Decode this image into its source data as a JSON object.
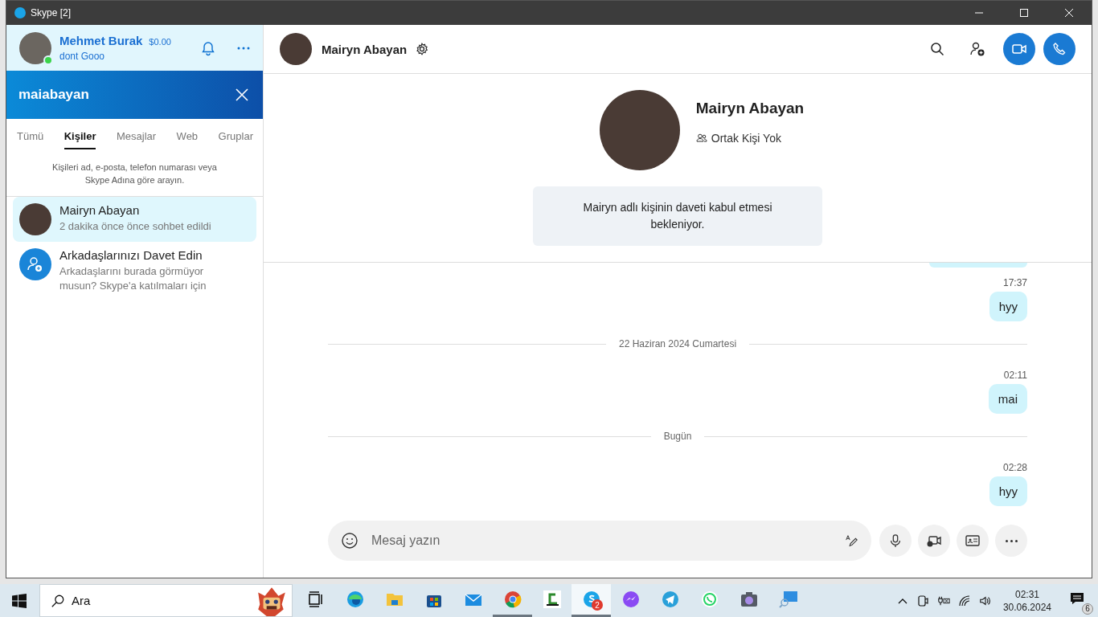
{
  "window": {
    "title": "Skype [2]"
  },
  "profile": {
    "name": "Mehmet Burak",
    "balance": "$0.00",
    "mood": "dont Gooo",
    "online": true
  },
  "search": {
    "query": "maiabayan"
  },
  "tabs": [
    {
      "label": "Tümü",
      "selected": false
    },
    {
      "label": "Kişiler",
      "selected": true
    },
    {
      "label": "Mesajlar",
      "selected": false
    },
    {
      "label": "Web",
      "selected": false
    },
    {
      "label": "Gruplar",
      "selected": false
    }
  ],
  "search_hint": "Kişileri ad, e-posta, telefon numarası veya Skype Adına göre arayın.",
  "results": [
    {
      "kind": "contact",
      "name": "Mairyn Abayan",
      "subtitle": "2 dakika önce önce sohbet edildi",
      "selected": true
    },
    {
      "kind": "invite",
      "name": "Arkadaşlarınızı Davet Edin",
      "subtitle": "Arkadaşlarını burada görmüyor musun? Skype'a katılmaları için",
      "selected": false
    }
  ],
  "chat": {
    "contact_name": "Mairyn Abayan",
    "card": {
      "name": "Mairyn Abayan",
      "mutual": "Ortak Kişi Yok",
      "notice": "Mairyn adlı kişinin daveti kabul etmesi bekleniyor."
    },
    "messages": [
      {
        "kind": "clipped"
      },
      {
        "kind": "message",
        "time": "17:37",
        "text": "hyy"
      },
      {
        "kind": "divider",
        "text": "22 Haziran 2024 Cumartesi"
      },
      {
        "kind": "message",
        "time": "02:11",
        "text": "mai"
      },
      {
        "kind": "divider",
        "text": "Bugün"
      },
      {
        "kind": "message",
        "time": "02:28",
        "text": "hyy"
      }
    ],
    "compose": {
      "placeholder": "Mesaj yazın"
    }
  },
  "taskbar": {
    "search_placeholder": "Ara",
    "apps": [
      {
        "kind": "taskview",
        "running": false,
        "selected": false
      },
      {
        "kind": "edge",
        "running": false,
        "selected": false
      },
      {
        "kind": "folder",
        "running": false,
        "selected": false
      },
      {
        "kind": "store",
        "running": false,
        "selected": false
      },
      {
        "kind": "mail",
        "running": false,
        "selected": false
      },
      {
        "kind": "chrome",
        "running": true,
        "selected": false
      },
      {
        "kind": "letter",
        "running": false,
        "selected": false
      },
      {
        "kind": "skype",
        "running": true,
        "selected": true,
        "badge": "2"
      },
      {
        "kind": "messenger",
        "running": false,
        "selected": false
      },
      {
        "kind": "telegram",
        "running": false,
        "selected": false
      },
      {
        "kind": "whatsapp",
        "running": false,
        "selected": false
      },
      {
        "kind": "camera",
        "running": false,
        "selected": false
      },
      {
        "kind": "screen",
        "running": false,
        "selected": false
      }
    ],
    "time": "02:31",
    "date": "30.06.2024",
    "notifications": "6"
  }
}
